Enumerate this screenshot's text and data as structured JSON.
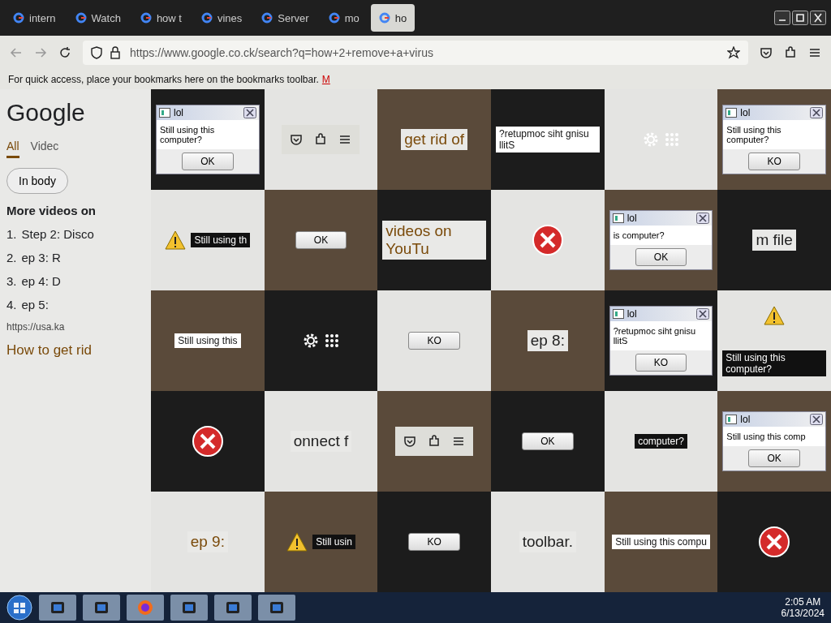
{
  "tabs": [
    {
      "label": "intern",
      "selected": false
    },
    {
      "label": "Watch",
      "selected": false
    },
    {
      "label": "how t",
      "selected": false
    },
    {
      "label": "vines",
      "selected": false
    },
    {
      "label": "Server",
      "selected": false
    },
    {
      "label": "mo",
      "selected": false
    },
    {
      "label": "ho",
      "selected": true
    }
  ],
  "address_bar": {
    "value": "https://www.google.co.ck/search?q=how+2+remove+a+virus"
  },
  "bookmarks_bar": {
    "text": "For quick access, place your bookmarks here on the bookmarks toolbar.",
    "link": "M"
  },
  "search_page": {
    "logo": "Google",
    "search_tabs": [
      {
        "label": "All",
        "selected": true
      },
      {
        "label": "Videc",
        "selected": false
      }
    ],
    "chip": "In body",
    "heading": "More videos on",
    "steps": [
      {
        "number": "1.",
        "text": "Step 2: Disco"
      },
      {
        "number": "2.",
        "text": "ep 3: R"
      },
      {
        "number": "3.",
        "text": "ep 4: D"
      },
      {
        "number": "4.",
        "text": "ep 5:"
      }
    ],
    "url": "https://usa.ka",
    "result_title": "How to get rid"
  },
  "fragments": [
    {
      "kind": "dialog",
      "title": "lol",
      "message": "Still using this computer?",
      "button": "OK"
    },
    {
      "kind": "toolbar"
    },
    {
      "kind": "text",
      "text": "get rid of"
    },
    {
      "kind": "message",
      "text": "?retupmoc siht gnisu llitS"
    },
    {
      "kind": "settings"
    },
    {
      "kind": "dialog",
      "title": "lol",
      "message": "Still using this computer?",
      "button": "KO"
    },
    {
      "kind": "alert",
      "text": "Still using th"
    },
    {
      "kind": "button",
      "text": "OK"
    },
    {
      "kind": "text",
      "text": "videos on YouTu"
    },
    {
      "kind": "error"
    },
    {
      "kind": "dialog",
      "title": "lol",
      "message": "is computer?",
      "button": "OK"
    },
    {
      "kind": "text",
      "text": "m file"
    },
    {
      "kind": "message",
      "text": "Still using this"
    },
    {
      "kind": "settings"
    },
    {
      "kind": "button",
      "text": "KO"
    },
    {
      "kind": "text",
      "text": "ep 8:"
    },
    {
      "kind": "dialog",
      "title": "lol",
      "message": "?retupmoc siht gnisu llitS",
      "button": "KO"
    },
    {
      "kind": "alert",
      "text": "Still using this computer?"
    },
    {
      "kind": "error"
    },
    {
      "kind": "text",
      "text": "onnect f"
    },
    {
      "kind": "toolbar"
    },
    {
      "kind": "button",
      "text": "OK"
    },
    {
      "kind": "message",
      "text": "computer?"
    },
    {
      "kind": "dialog",
      "title": "lol",
      "message": "Still using this comp",
      "button": "OK"
    },
    {
      "kind": "text",
      "text": "ep 9:"
    },
    {
      "kind": "alert",
      "text": "Still usin"
    },
    {
      "kind": "button",
      "text": "KO"
    },
    {
      "kind": "text",
      "text": "toolbar."
    },
    {
      "kind": "message",
      "text": "Still using this compu"
    },
    {
      "kind": "error"
    }
  ],
  "taskbar": {
    "time": "2:05 AM",
    "date": "6/13/2024"
  }
}
